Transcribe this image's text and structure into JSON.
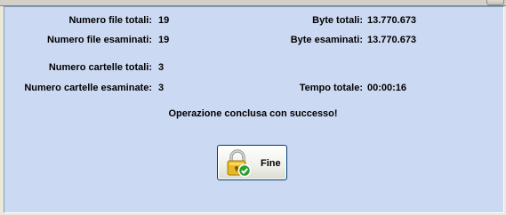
{
  "stats": {
    "total_files_label": "Numero file totali:",
    "total_files_value": "19",
    "examined_files_label": "Numero file esaminati:",
    "examined_files_value": "19",
    "total_folders_label": "Numero cartelle totali:",
    "total_folders_value": "3",
    "examined_folders_label": "Numero cartelle esaminate:",
    "examined_folders_value": "3",
    "total_bytes_label": "Byte totali:",
    "total_bytes_value": "13.770.673",
    "examined_bytes_label": "Byte esaminati:",
    "examined_bytes_value": "13.770.673",
    "total_time_label": "Tempo totale:",
    "total_time_value": "00:00:16"
  },
  "status_message": "Operazione conclusa con successo!",
  "finish_button": {
    "label": "Fine",
    "icon": "padlock-check-icon"
  },
  "colors": {
    "panel_bg": "#ccd9f2",
    "window_bg": "#ece9d8",
    "lock_gold": "#e8b820",
    "check_green": "#2e9e2e"
  }
}
